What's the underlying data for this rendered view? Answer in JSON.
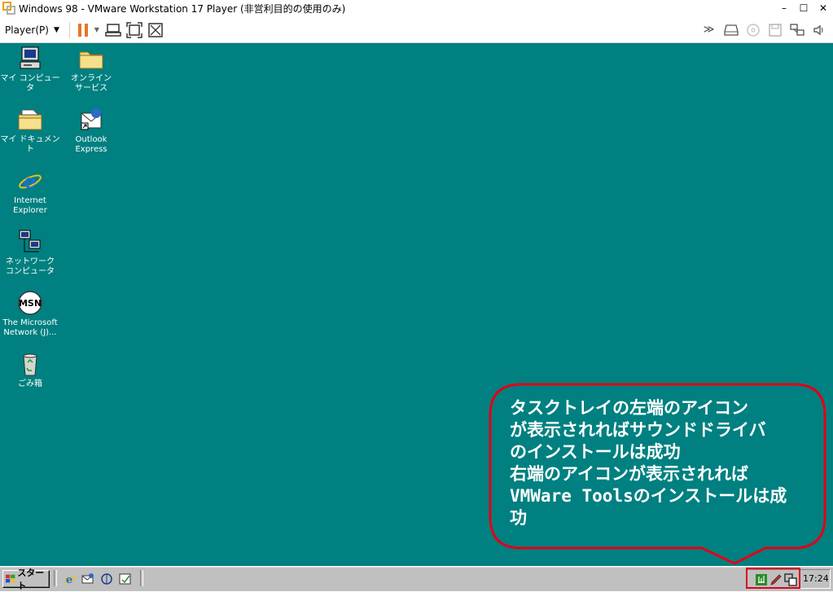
{
  "window": {
    "title": "Windows 98 - VMware Workstation 17 Player (非営利目的の使用のみ)",
    "minimize": "–",
    "maximize": "☐",
    "close": "✕"
  },
  "toolbar": {
    "player_menu": "Player(P)",
    "left_icons": [
      "pause-icon",
      "send-ctrl-alt-del-icon",
      "fit-guest-icon",
      "unity-icon"
    ],
    "right_icons": [
      "more-devices-icon",
      "hdd-icon",
      "cd-icon",
      "floppy-icon",
      "network-icon",
      "sound-icon"
    ]
  },
  "desktop": {
    "background": "#008080",
    "icons": [
      {
        "label": "マイ コンピュータ",
        "icon": "my-computer-icon"
      },
      {
        "label": "オンライン\nサービス",
        "icon": "folder-icon"
      },
      {
        "label": "マイ ドキュメント",
        "icon": "my-documents-icon"
      },
      {
        "label": "Outlook\nExpress",
        "icon": "outlook-express-icon"
      },
      {
        "label": "Internet\nExplorer",
        "icon": "internet-explorer-icon"
      },
      {
        "label": "ネットワーク\nコンピュータ",
        "icon": "network-computer-icon"
      },
      {
        "label": "The Microsoft\nNetwork (J)...",
        "icon": "msn-icon"
      },
      {
        "label": "ごみ箱",
        "icon": "recycle-bin-icon"
      }
    ]
  },
  "callout": {
    "text": "タスクトレイの左端のアイコン\nが表示されればサウンドドライバ\nのインストールは成功\n右端のアイコンが表示されれば\nVMWare Toolsのインストールは成\n功",
    "border_color": "#e0001a"
  },
  "taskbar": {
    "start_label": "スタート",
    "quick_launch": [
      "ie-icon",
      "outlook-icon",
      "channels-icon",
      "show-desktop-icon"
    ],
    "tray_icons": [
      "sound-driver-icon",
      "pen-icon",
      "vmware-tools-icon"
    ],
    "clock": "17:24"
  }
}
